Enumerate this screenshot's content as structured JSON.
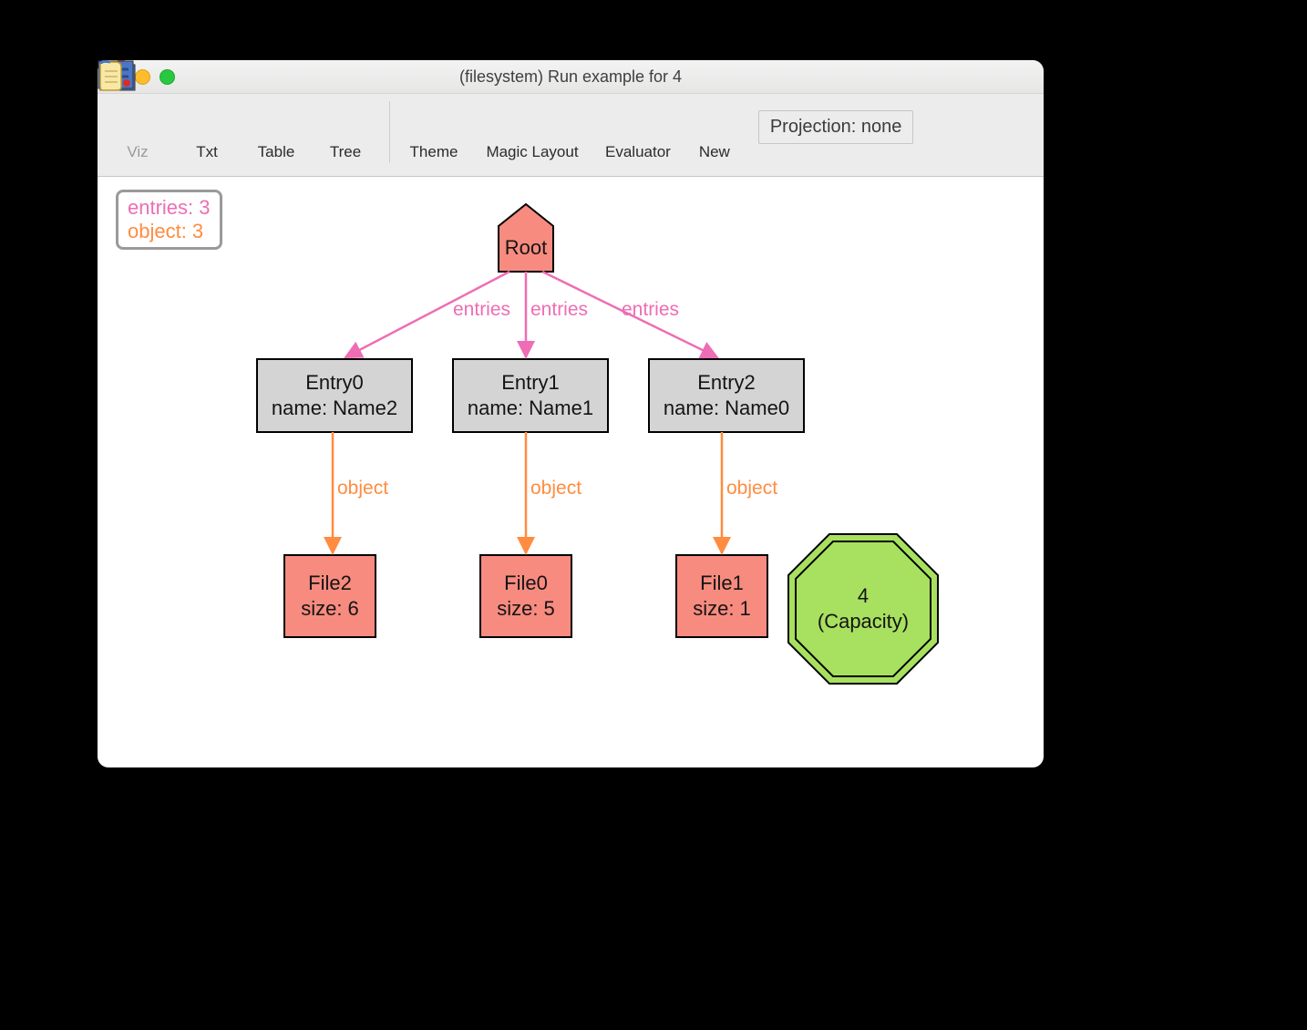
{
  "window": {
    "title": "(filesystem) Run example for 4"
  },
  "toolbar": {
    "viz": "Viz",
    "txt": "Txt",
    "table": "Table",
    "tree": "Tree",
    "theme": "Theme",
    "magic_layout": "Magic Layout",
    "evaluator": "Evaluator",
    "new": "New",
    "projection": "Projection: none"
  },
  "legend": {
    "entries": "entries: 3",
    "object": "object: 3"
  },
  "edges": {
    "entries1": "entries",
    "entries2": "entries",
    "entries3": "entries",
    "object1": "object",
    "object2": "object",
    "object3": "object"
  },
  "nodes": {
    "root": "Root",
    "entry0": {
      "title": "Entry0",
      "name": "name: Name2"
    },
    "entry1": {
      "title": "Entry1",
      "name": "name: Name1"
    },
    "entry2": {
      "title": "Entry2",
      "name": "name: Name0"
    },
    "file2": {
      "title": "File2",
      "size": "size: 6"
    },
    "file0": {
      "title": "File0",
      "size": "size: 5"
    },
    "file1": {
      "title": "File1",
      "size": "size: 1"
    },
    "capacity": {
      "value": "4",
      "label": "(Capacity)"
    }
  },
  "colors": {
    "salmon": "#f78b7f",
    "grey": "#d4d4d4",
    "green": "#a8e05f",
    "pink_edge": "#ee6db4",
    "orange_edge": "#ff8c40"
  }
}
